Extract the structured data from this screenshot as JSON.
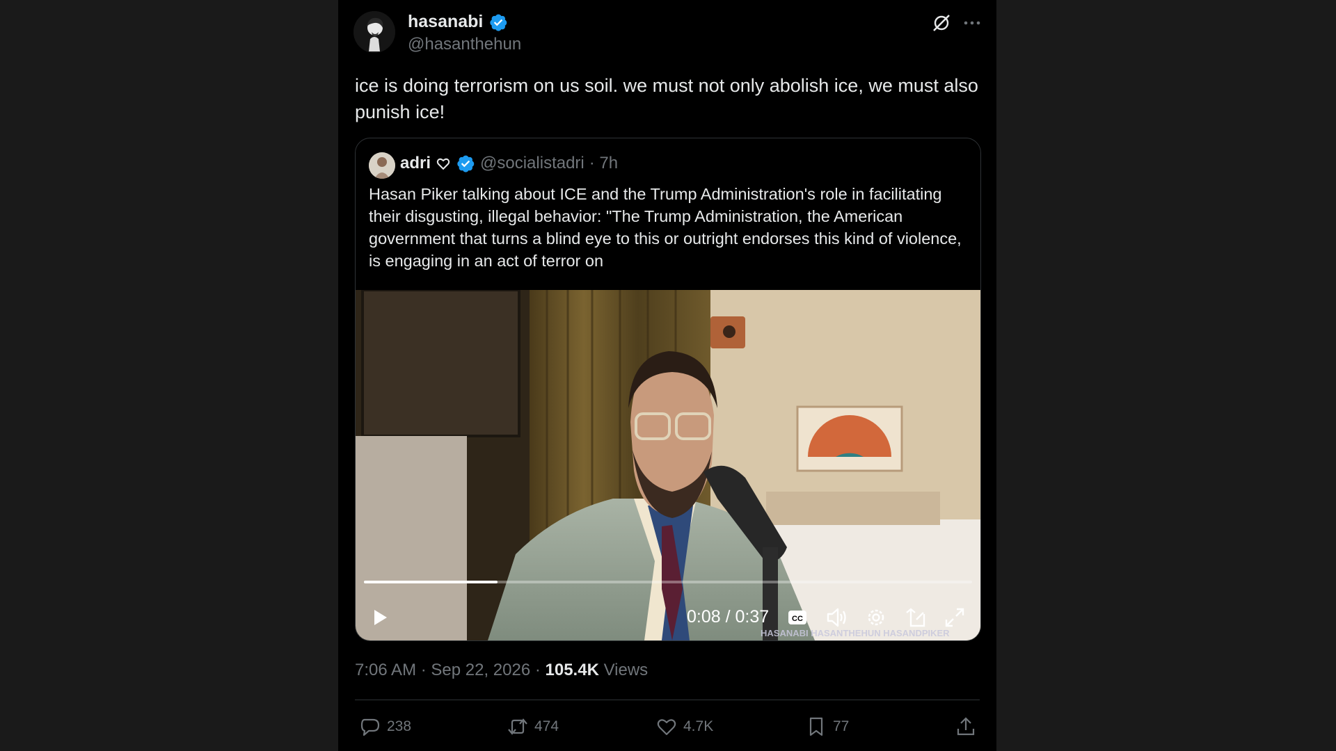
{
  "tweet": {
    "display_name": "hasanabi",
    "handle": "@hasanthehun",
    "text": "ice is doing terrorism on us soil. we must not only abolish ice, we must also punish ice!",
    "timestamp": "7:06 AM · Sep 22, 2026 · ",
    "views_count": "105.4K",
    "views_label": " Views"
  },
  "quote": {
    "display_name": "adri",
    "handle": "@socialistadri",
    "age": "· 7h",
    "text": "Hasan Piker talking about ICE and the Trump Administration's role in facilitating their disgusting, illegal behavior: \"The Trump Administration, the American government that turns a blind eye to this or outright endorses this kind of violence, is engaging in an act of terror on"
  },
  "video": {
    "time": "0:08 / 0:37",
    "progress": 0.22,
    "watermark": "HASANABI  HASANTHEHUN  HASANDPIKER"
  },
  "actions": {
    "replies": "238",
    "reposts": "474",
    "likes": "4.7K",
    "bookmarks": "77"
  },
  "colors": {
    "verified": "#1d9bf0",
    "background": "#000000",
    "muted": "#71767b"
  },
  "icons": [
    "grok-icon",
    "more-icon",
    "verified-icon",
    "heart-emoji-icon",
    "play-icon",
    "captions-icon",
    "volume-icon",
    "settings-icon",
    "pip-icon",
    "fullscreen-icon",
    "reply-icon",
    "repost-icon",
    "like-icon",
    "bookmark-icon",
    "share-icon"
  ]
}
